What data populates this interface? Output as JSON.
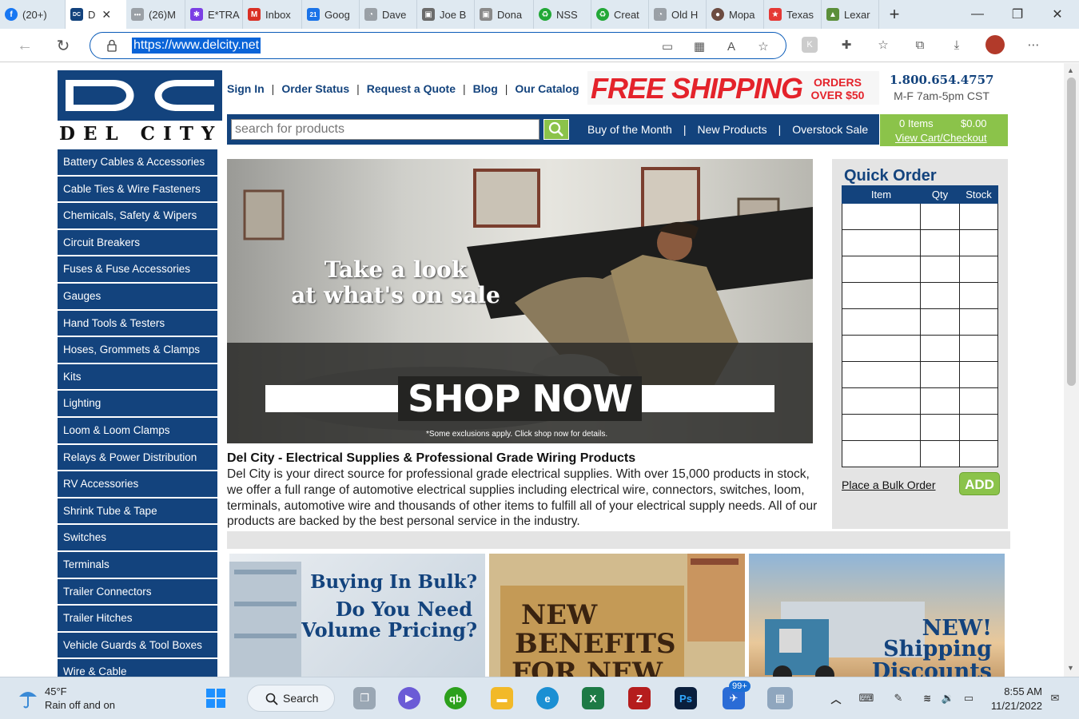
{
  "browser": {
    "tabs": [
      {
        "label": "(20+)",
        "color": "#1877f2",
        "glyph": "f"
      },
      {
        "label": "D",
        "color": "#13437d",
        "glyph": "DC",
        "active": true
      },
      {
        "label": "(26)M",
        "color": "#7a7a7a",
        "glyph": "•••"
      },
      {
        "label": "E*TRA",
        "color": "#7b3fe4",
        "glyph": "✱"
      },
      {
        "label": "Inbox",
        "color": "#d93025",
        "glyph": "M"
      },
      {
        "label": "Goog",
        "color": "#1a73e8",
        "glyph": "21"
      },
      {
        "label": "Dave",
        "color": "#9aa0a6",
        "glyph": "◔"
      },
      {
        "label": "Joe B",
        "color": "#6b6b6b",
        "glyph": "▣"
      },
      {
        "label": "Dona",
        "color": "#8a8a8a",
        "glyph": "▣"
      },
      {
        "label": "NSS",
        "color": "#22a837",
        "glyph": "♻"
      },
      {
        "label": "Creat",
        "color": "#22a837",
        "glyph": "♻"
      },
      {
        "label": "Old H",
        "color": "#9aa0a6",
        "glyph": "◔"
      },
      {
        "label": "Mopa",
        "color": "#6d4c41",
        "glyph": "●"
      },
      {
        "label": "Texas",
        "color": "#e53935",
        "glyph": "★"
      },
      {
        "label": "Lexar",
        "color": "#5b8f3a",
        "glyph": "▲"
      }
    ],
    "new_tab": "+",
    "url": "https://www.delcity.net"
  },
  "site": {
    "logo_text": "DEL CITY",
    "toplinks": [
      "Sign In",
      "Order Status",
      "Request a Quote",
      "Blog",
      "Our Catalog"
    ],
    "free_shipping": "FREE SHIPPING",
    "orders_over": "ORDERS OVER $50",
    "phone": "1.800.654.4757",
    "hours": "M-F 7am-5pm CST",
    "search_placeholder": "search for products",
    "navlinks": [
      "Buy of the Month",
      "New Products",
      "Overstock Sale"
    ],
    "cart_items": "0 Items",
    "cart_total": "$0.00",
    "cart_link": "View Cart/Checkout",
    "categories": [
      "Battery Cables & Accessories",
      "Cable Ties & Wire Fasteners",
      "Chemicals, Safety & Wipers",
      "Circuit Breakers",
      "Fuses & Fuse Accessories",
      "Gauges",
      "Hand Tools & Testers",
      "Hoses, Grommets & Clamps",
      "Kits",
      "Lighting",
      "Loom & Loom Clamps",
      "Relays & Power Distribution",
      "RV Accessories",
      "Shrink Tube & Tape",
      "Switches",
      "Terminals",
      "Trailer Connectors",
      "Trailer Hitches",
      "Vehicle Guards & Tool Boxes",
      "Wire & Cable"
    ],
    "hero": {
      "line1": "Take a look",
      "line2": "at what's on sale",
      "cta": "SHOP NOW",
      "fine": "*Some exclusions apply. Click shop now for details."
    },
    "intro_title": "Del City - Electrical Supplies & Professional Grade Wiring Products",
    "intro_body": "Del City is your direct source for professional grade electrical supplies. With over 15,000 products in stock, we offer a full range of automotive electrical supplies including electrical wire, connectors, switches, loom, terminals, automotive wire and thousands of other items to fulfill all of your electrical supply needs. All of our products are backed by the best personal service in the industry.",
    "quick_order": {
      "title": "Quick Order",
      "columns": [
        "Item",
        "Qty",
        "Stock"
      ],
      "bulk_link": "Place a Bulk Order",
      "add_label": "ADD"
    },
    "promos": [
      {
        "l1": "Buying In Bulk?",
        "l2": "Do You Need",
        "l3": "Volume Pricing?"
      },
      {
        "l1": "NEW",
        "l2": "BENEFITS",
        "l3": "FOR NEW"
      },
      {
        "l1": "NEW!",
        "l2": "Shipping",
        "l3": "Discounts"
      }
    ]
  },
  "taskbar": {
    "temp": "45°F",
    "condition": "Rain off and on",
    "search": "Search",
    "badge": "99+",
    "time": "8:55 AM",
    "date": "11/21/2022"
  },
  "colors": {
    "brand_blue": "#13437d",
    "accent_green": "#8bc34a",
    "promo_red": "#e4232b"
  }
}
